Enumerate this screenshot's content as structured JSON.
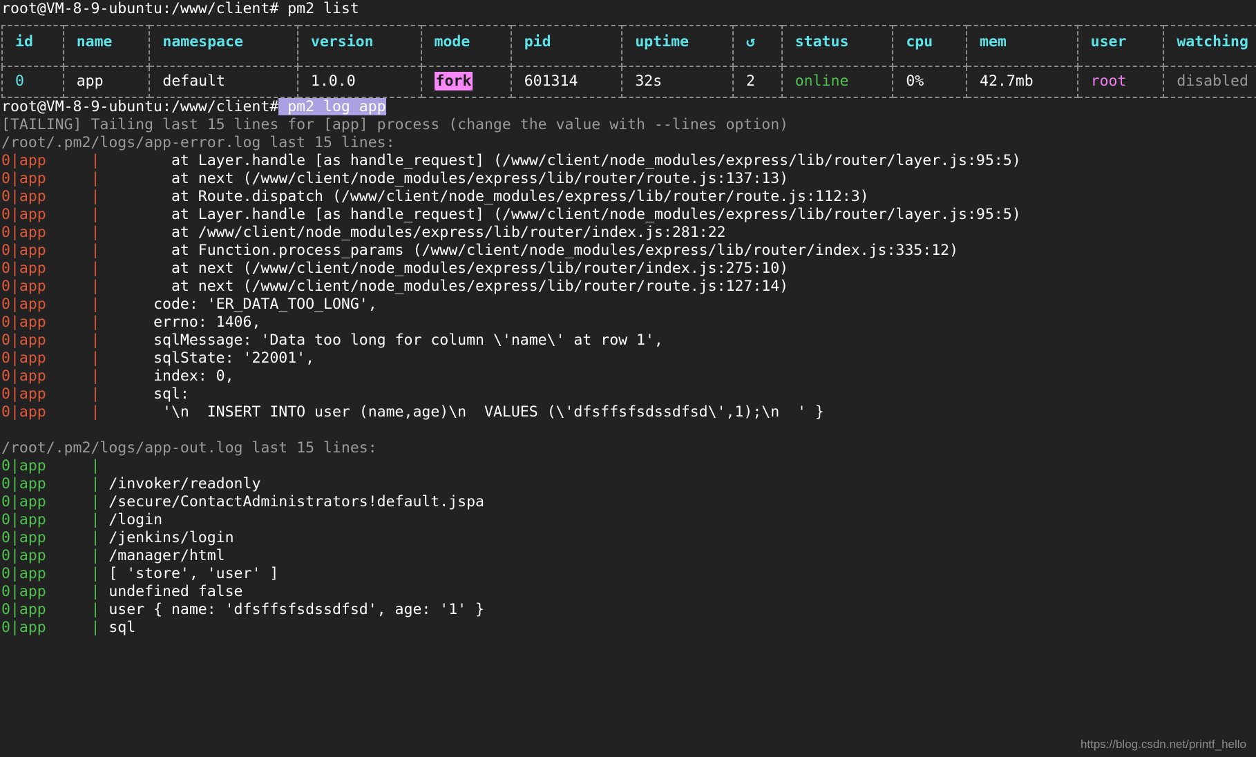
{
  "terminal": {
    "background": "#222222",
    "foreground": "#ffffff",
    "prompt": "root@VM-8-9-ubuntu:/www/client#",
    "command_1": " pm2 list",
    "command_2_selected": " pm2 log app",
    "selection_color": "#a9a1e1"
  },
  "pm2_table": {
    "headers": [
      "id",
      "name",
      "namespace",
      "version",
      "mode",
      "pid",
      "uptime",
      "↺",
      "status",
      "cpu",
      "mem",
      "user",
      "watching"
    ],
    "row": {
      "id": "0",
      "name": "app",
      "namespace": "default",
      "version": "1.0.0",
      "mode": "fork",
      "pid": "601314",
      "uptime": "32s",
      "restarts": "2",
      "status": "online",
      "cpu": "0%",
      "mem": "42.7mb",
      "user": "root",
      "watching": "disabled"
    }
  },
  "tailing_notice": "[TAILING] Tailing last 15 lines for [app] process (change the value with --lines option)",
  "error_log": {
    "header": "/root/.pm2/logs/app-error.log last 15 lines:",
    "prefix": "0|app     | ",
    "prefix_color": "#e05a3a",
    "lines": [
      "       at Layer.handle [as handle_request] (/www/client/node_modules/express/lib/router/layer.js:95:5)",
      "       at next (/www/client/node_modules/express/lib/router/route.js:137:13)",
      "       at Route.dispatch (/www/client/node_modules/express/lib/router/route.js:112:3)",
      "       at Layer.handle [as handle_request] (/www/client/node_modules/express/lib/router/layer.js:95:5)",
      "       at /www/client/node_modules/express/lib/router/index.js:281:22",
      "       at Function.process_params (/www/client/node_modules/express/lib/router/index.js:335:12)",
      "       at next (/www/client/node_modules/express/lib/router/index.js:275:10)",
      "       at next (/www/client/node_modules/express/lib/router/route.js:127:14)",
      "     code: 'ER_DATA_TOO_LONG',",
      "     errno: 1406,",
      "     sqlMessage: 'Data too long for column \\'name\\' at row 1',",
      "     sqlState: '22001',",
      "     index: 0,",
      "     sql:",
      "      '\\n  INSERT INTO user (name,age)\\n  VALUES (\\'dfsffsfsdssdfsd\\',1);\\n  ' }"
    ]
  },
  "out_log": {
    "header": "/root/.pm2/logs/app-out.log last 15 lines:",
    "prefix": "0|app     | ",
    "prefix_color": "#4fc24f",
    "lines": [
      "",
      "/invoker/readonly",
      "/secure/ContactAdministrators!default.jspa",
      "/login",
      "/jenkins/login",
      "/manager/html",
      "[ 'store', 'user' ]",
      "undefined false",
      "user { name: 'dfsffsfsdssdfsd', age: '1' }",
      "sql"
    ]
  },
  "watermark": "https://blog.csdn.net/printf_hello"
}
